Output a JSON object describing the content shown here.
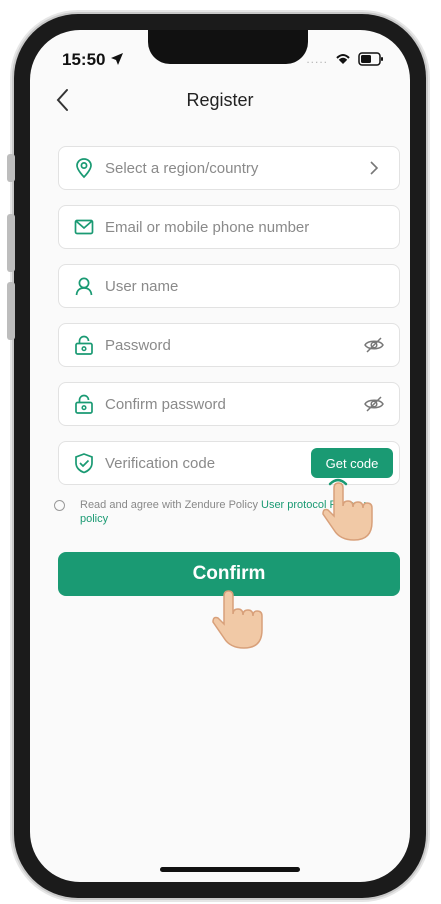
{
  "status_bar": {
    "time": "15:50"
  },
  "nav": {
    "title": "Register"
  },
  "form": {
    "region_placeholder": "Select a region/country",
    "email_placeholder": "Email or mobile phone number",
    "username_placeholder": "User name",
    "password_placeholder": "Password",
    "confirm_password_placeholder": "Confirm password",
    "verification_placeholder": "Verification code",
    "get_code_label": "Get code"
  },
  "agreement": {
    "text": "Read and agree with Zendure Policy ",
    "user_protocol": "User protocol",
    "separator": " ",
    "privacy_policy": "Privacy policy"
  },
  "confirm_label": "Confirm",
  "colors": {
    "accent": "#1a9a73",
    "background": "#fafafa",
    "field_border": "#e2e2e2"
  },
  "icons": [
    "location-icon",
    "mail-icon",
    "user-icon",
    "lock-icon",
    "eye-off-icon",
    "shield-check-icon",
    "chevron-right-icon",
    "back-chevron-icon",
    "tap-hand-icon"
  ]
}
